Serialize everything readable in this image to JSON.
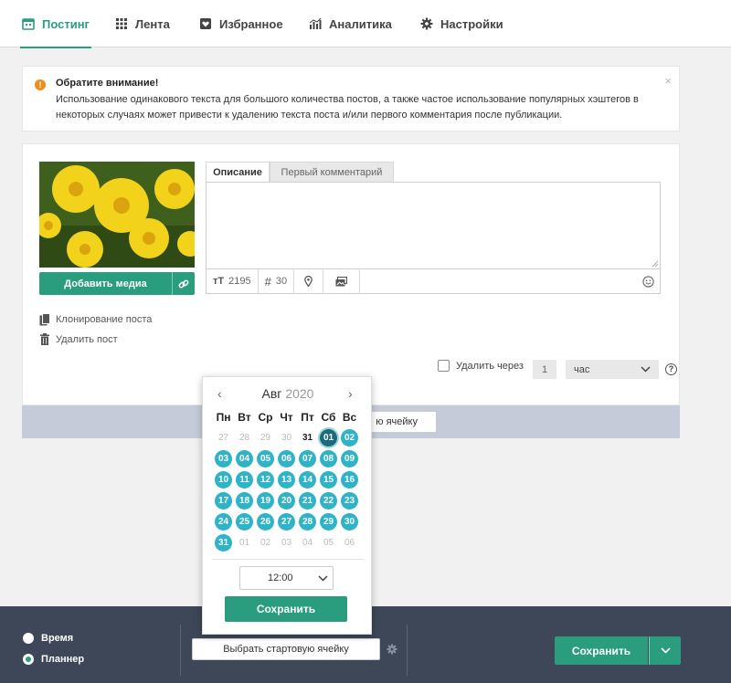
{
  "nav": {
    "tabs": [
      {
        "label": "Постинг",
        "icon": "calendar-icon",
        "active": true
      },
      {
        "label": "Лента",
        "icon": "grid-icon",
        "active": false
      },
      {
        "label": "Избранное",
        "icon": "heart-icon",
        "active": false
      },
      {
        "label": "Аналитика",
        "icon": "chart-icon",
        "active": false
      },
      {
        "label": "Настройки",
        "icon": "gear-icon",
        "active": false
      }
    ]
  },
  "alert": {
    "title": "Обратите внимание!",
    "text": "Использование одинакового текста для большого количества постов, а также частое использование популярных хэштегов в некоторых случаях может привести к удалению текста поста и/или первого комментария после публикации.",
    "icon": "exclamation-icon",
    "close": "×"
  },
  "post": {
    "add_media": "Добавить медиа",
    "clone": "Клонирование поста",
    "delete": "Удалить пост",
    "tabs": {
      "description": "Описание",
      "first_comment": "Первый комментарий"
    },
    "toolbar": {
      "chars": "2195",
      "hashtags": "30"
    },
    "delete_after": {
      "label": "Удалить через",
      "value": "1",
      "unit": "час",
      "help": "?"
    }
  },
  "cell_button": "ю ячейку",
  "calendar": {
    "month": "Авг",
    "year": "2020",
    "prev": "‹",
    "next": "›",
    "weekdays": [
      "Пн",
      "Вт",
      "Ср",
      "Чт",
      "Пт",
      "Сб",
      "Вс"
    ],
    "days": [
      {
        "d": "27",
        "s": "muted"
      },
      {
        "d": "28",
        "s": "muted"
      },
      {
        "d": "29",
        "s": "muted"
      },
      {
        "d": "30",
        "s": "muted"
      },
      {
        "d": "31",
        "s": "plain"
      },
      {
        "d": "01",
        "s": "sel"
      },
      {
        "d": "02",
        "s": "avail"
      },
      {
        "d": "03",
        "s": "avail"
      },
      {
        "d": "04",
        "s": "avail"
      },
      {
        "d": "05",
        "s": "avail"
      },
      {
        "d": "06",
        "s": "avail"
      },
      {
        "d": "07",
        "s": "avail"
      },
      {
        "d": "08",
        "s": "avail"
      },
      {
        "d": "09",
        "s": "avail"
      },
      {
        "d": "10",
        "s": "avail"
      },
      {
        "d": "11",
        "s": "avail"
      },
      {
        "d": "12",
        "s": "avail"
      },
      {
        "d": "13",
        "s": "avail"
      },
      {
        "d": "14",
        "s": "avail"
      },
      {
        "d": "15",
        "s": "avail"
      },
      {
        "d": "16",
        "s": "avail"
      },
      {
        "d": "17",
        "s": "avail"
      },
      {
        "d": "18",
        "s": "avail"
      },
      {
        "d": "19",
        "s": "avail"
      },
      {
        "d": "20",
        "s": "avail"
      },
      {
        "d": "21",
        "s": "avail"
      },
      {
        "d": "22",
        "s": "avail"
      },
      {
        "d": "23",
        "s": "avail"
      },
      {
        "d": "24",
        "s": "avail"
      },
      {
        "d": "25",
        "s": "avail"
      },
      {
        "d": "26",
        "s": "avail"
      },
      {
        "d": "27",
        "s": "avail"
      },
      {
        "d": "28",
        "s": "avail"
      },
      {
        "d": "29",
        "s": "avail"
      },
      {
        "d": "30",
        "s": "avail"
      },
      {
        "d": "31",
        "s": "avail"
      },
      {
        "d": "01",
        "s": "muted"
      },
      {
        "d": "02",
        "s": "muted"
      },
      {
        "d": "03",
        "s": "muted"
      },
      {
        "d": "04",
        "s": "muted"
      },
      {
        "d": "05",
        "s": "muted"
      },
      {
        "d": "06",
        "s": "muted"
      }
    ],
    "time": "12:00",
    "save": "Сохранить"
  },
  "footer": {
    "mode_time": "Время",
    "mode_planner": "Планнер",
    "selected_mode": "Планнер",
    "start_cell": "Выбрать стартовую ячейку",
    "save": "Сохранить"
  },
  "colors": {
    "accent": "#2a9d7e",
    "day_available": "#2fb3c7",
    "day_selected": "#1c6b7a",
    "footer": "#3d4757",
    "alert_icon": "#f08c1c"
  }
}
